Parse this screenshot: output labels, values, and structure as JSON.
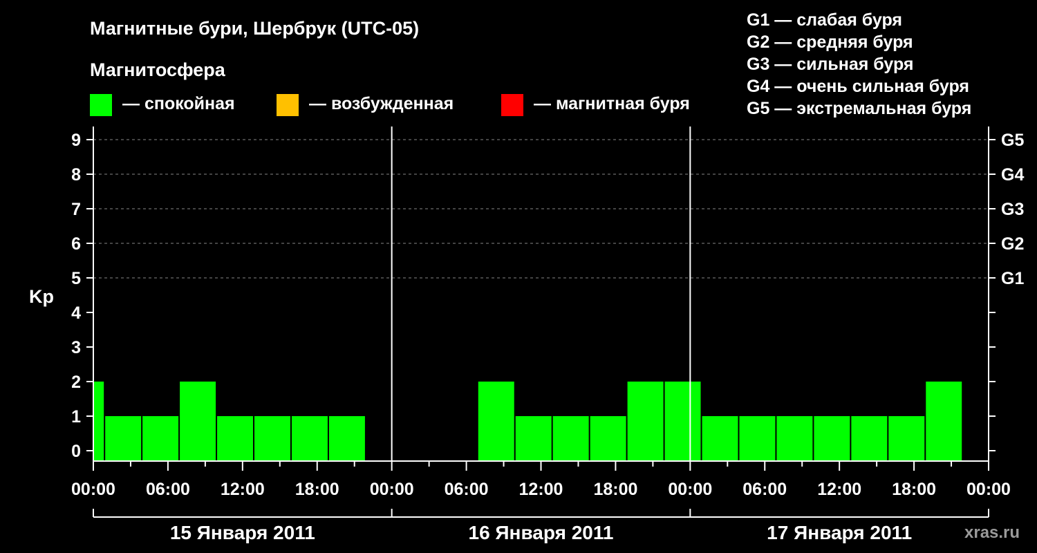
{
  "title": "Магнитные бури, Шербрук (UTC-05)",
  "legend": {
    "heading": "Магнитосфера",
    "items": [
      {
        "label": "— спокойная",
        "color": "#00ff00"
      },
      {
        "label": "— возбужденная",
        "color": "#ffc000"
      },
      {
        "label": "— магнитная буря",
        "color": "#ff0000"
      }
    ],
    "g_scale": [
      "G1 — слабая буря",
      "G2 — средняя буря",
      "G3 — сильная буря",
      "G4 — очень сильная буря",
      "G5 — экстремальная буря"
    ]
  },
  "watermark": "xras.ru",
  "chart_data": {
    "type": "bar",
    "ylabel": "Kp",
    "ylim": [
      0,
      9
    ],
    "y_ticks": [
      "0",
      "1",
      "2",
      "3",
      "4",
      "5",
      "6",
      "7",
      "8",
      "9"
    ],
    "right_ticks": [
      {
        "value": 5,
        "label": "G1"
      },
      {
        "value": 6,
        "label": "G2"
      },
      {
        "value": 7,
        "label": "G3"
      },
      {
        "value": 8,
        "label": "G4"
      },
      {
        "value": 9,
        "label": "G5"
      }
    ],
    "x_tick_labels": [
      "00:00",
      "06:00",
      "12:00",
      "18:00",
      "00:00",
      "06:00",
      "12:00",
      "18:00",
      "00:00",
      "06:00",
      "12:00",
      "18:00",
      "00:00"
    ],
    "days": [
      "15 Января 2011",
      "16 Января 2011",
      "17 Января 2011"
    ],
    "bar_color": "#00ff00",
    "grid": true,
    "bars": [
      {
        "start_hour": 0.0,
        "end_hour": 0.9,
        "value": 2
      },
      {
        "start_hour": 0.9,
        "end_hour": 3.9,
        "value": 1
      },
      {
        "start_hour": 3.9,
        "end_hour": 6.9,
        "value": 1
      },
      {
        "start_hour": 6.9,
        "end_hour": 9.9,
        "value": 2
      },
      {
        "start_hour": 9.9,
        "end_hour": 12.9,
        "value": 1
      },
      {
        "start_hour": 12.9,
        "end_hour": 15.9,
        "value": 1
      },
      {
        "start_hour": 15.9,
        "end_hour": 18.9,
        "value": 1
      },
      {
        "start_hour": 18.9,
        "end_hour": 21.9,
        "value": 1
      },
      {
        "start_hour": 30.9,
        "end_hour": 33.9,
        "value": 2
      },
      {
        "start_hour": 33.9,
        "end_hour": 36.9,
        "value": 1
      },
      {
        "start_hour": 36.9,
        "end_hour": 39.9,
        "value": 1
      },
      {
        "start_hour": 39.9,
        "end_hour": 42.9,
        "value": 1
      },
      {
        "start_hour": 42.9,
        "end_hour": 45.9,
        "value": 2
      },
      {
        "start_hour": 45.9,
        "end_hour": 48.9,
        "value": 2
      },
      {
        "start_hour": 48.9,
        "end_hour": 51.9,
        "value": 1
      },
      {
        "start_hour": 51.9,
        "end_hour": 54.9,
        "value": 1
      },
      {
        "start_hour": 54.9,
        "end_hour": 57.9,
        "value": 1
      },
      {
        "start_hour": 57.9,
        "end_hour": 60.9,
        "value": 1
      },
      {
        "start_hour": 60.9,
        "end_hour": 63.9,
        "value": 1
      },
      {
        "start_hour": 63.9,
        "end_hour": 66.9,
        "value": 1
      },
      {
        "start_hour": 66.9,
        "end_hour": 69.9,
        "value": 2
      }
    ]
  }
}
